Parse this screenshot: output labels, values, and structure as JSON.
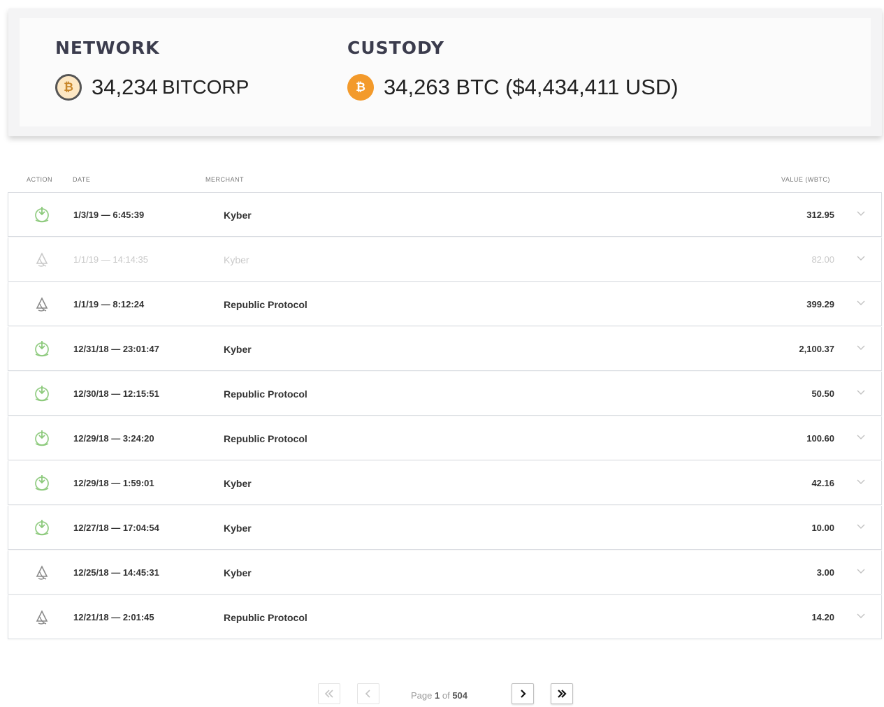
{
  "summary": {
    "network": {
      "label": "NETWORK",
      "amount": "34,234",
      "unit": "BITCORP",
      "icon": "bitcoin-outline-icon"
    },
    "custody": {
      "label": "CUSTODY",
      "amount_text": "34,263 BTC ($4,434,411 USD)",
      "icon": "bitcoin-icon",
      "icon_color": "#f39a2b"
    }
  },
  "table": {
    "headers": {
      "action": "ACTION",
      "date": "DATE",
      "merchant": "MERCHANT",
      "value": "VALUE (WBTC)"
    },
    "rows": [
      {
        "action": "deposit",
        "date": "1/3/19 — 6:45:39",
        "merchant": "Kyber",
        "value": "312.95",
        "faded": false
      },
      {
        "action": "withdraw",
        "date": "1/1/19 — 14:14:35",
        "merchant": "Kyber",
        "value": "82.00",
        "faded": true
      },
      {
        "action": "withdraw",
        "date": "1/1/19 — 8:12:24",
        "merchant": "Republic Protocol",
        "value": "399.29",
        "faded": false
      },
      {
        "action": "deposit",
        "date": "12/31/18 — 23:01:47",
        "merchant": "Kyber",
        "value": "2,100.37",
        "faded": false
      },
      {
        "action": "deposit",
        "date": "12/30/18 — 12:15:51",
        "merchant": "Republic Protocol",
        "value": "50.50",
        "faded": false
      },
      {
        "action": "deposit",
        "date": "12/29/18 — 3:24:20",
        "merchant": "Republic Protocol",
        "value": "100.60",
        "faded": false
      },
      {
        "action": "deposit",
        "date": "12/29/18 — 1:59:01",
        "merchant": "Kyber",
        "value": "42.16",
        "faded": false
      },
      {
        "action": "deposit",
        "date": "12/27/18 — 17:04:54",
        "merchant": "Kyber",
        "value": "10.00",
        "faded": false
      },
      {
        "action": "withdraw",
        "date": "12/25/18 — 14:45:31",
        "merchant": "Kyber",
        "value": "3.00",
        "faded": false
      },
      {
        "action": "withdraw",
        "date": "12/21/18 — 2:01:45",
        "merchant": "Republic Protocol",
        "value": "14.20",
        "faded": false
      }
    ]
  },
  "pagination": {
    "prefix": "Page",
    "current": "1",
    "separator": "of",
    "total": "504",
    "first_icon": "double-chevron-left-icon",
    "prev_icon": "chevron-left-icon",
    "next_icon": "chevron-right-icon",
    "last_icon": "double-chevron-right-icon"
  },
  "colors": {
    "deposit": "#8bc97a",
    "withdraw": "#8a8a8a",
    "accent": "#f39a2b",
    "label": "#3b3c4d"
  }
}
